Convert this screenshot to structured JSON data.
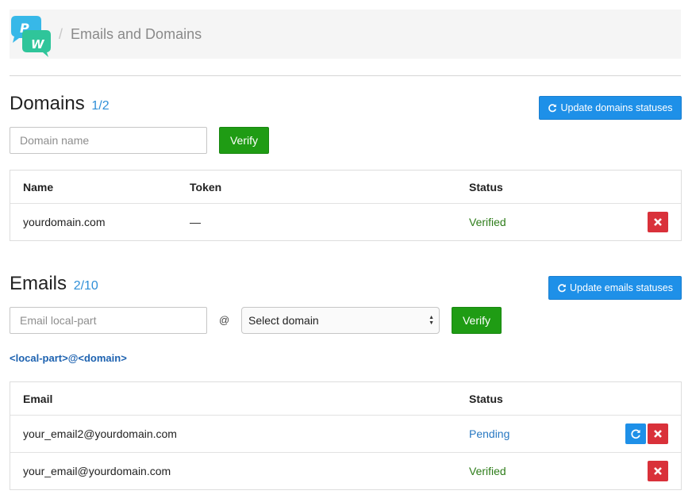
{
  "header": {
    "breadcrumb_sep": "/",
    "breadcrumb_title": "Emails and Domains"
  },
  "domains": {
    "title": "Domains",
    "count": "1/2",
    "update_button": "Update domains statuses",
    "input_placeholder": "Domain name",
    "verify_button": "Verify",
    "columns": [
      "Name",
      "Token",
      "Status"
    ],
    "rows": [
      {
        "name": "yourdomain.com",
        "token": "—",
        "status": "Verified"
      }
    ]
  },
  "emails": {
    "title": "Emails",
    "count": "2/10",
    "update_button": "Update emails statuses",
    "input_placeholder": "Email local-part",
    "at": "@",
    "select_value": "Select domain",
    "verify_button": "Verify",
    "hint": "<local-part>@<domain>",
    "columns": [
      "Email",
      "Status"
    ],
    "rows": [
      {
        "email": "your_email2@yourdomain.com",
        "status": "Pending"
      },
      {
        "email": "your_email@yourdomain.com",
        "status": "Verified"
      }
    ]
  },
  "colors": {
    "accent_blue": "#1e90e8",
    "verify_green": "#1f9c14",
    "delete_red": "#d9313a"
  },
  "icons": {
    "refresh": "refresh-icon",
    "delete": "close-icon"
  }
}
